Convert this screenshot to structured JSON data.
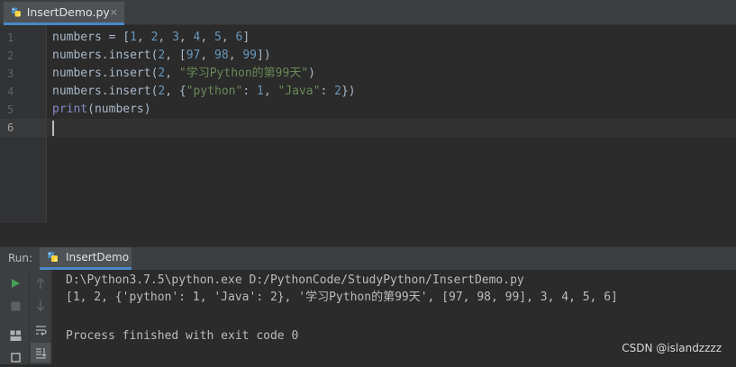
{
  "editor_tab": {
    "file_name": "InsertDemo.py",
    "close_glyph": "×"
  },
  "editor": {
    "line_numbers": [
      "1",
      "2",
      "3",
      "4",
      "5",
      "6"
    ],
    "lines": [
      [
        {
          "t": "numbers = [",
          "c": "p"
        },
        {
          "t": "1",
          "c": "n"
        },
        {
          "t": ", ",
          "c": "p"
        },
        {
          "t": "2",
          "c": "n"
        },
        {
          "t": ", ",
          "c": "p"
        },
        {
          "t": "3",
          "c": "n"
        },
        {
          "t": ", ",
          "c": "p"
        },
        {
          "t": "4",
          "c": "n"
        },
        {
          "t": ", ",
          "c": "p"
        },
        {
          "t": "5",
          "c": "n"
        },
        {
          "t": ", ",
          "c": "p"
        },
        {
          "t": "6",
          "c": "n"
        },
        {
          "t": "]",
          "c": "p"
        }
      ],
      [
        {
          "t": "numbers.insert(",
          "c": "p"
        },
        {
          "t": "2",
          "c": "n"
        },
        {
          "t": ", [",
          "c": "p"
        },
        {
          "t": "97",
          "c": "n"
        },
        {
          "t": ", ",
          "c": "p"
        },
        {
          "t": "98",
          "c": "n"
        },
        {
          "t": ", ",
          "c": "p"
        },
        {
          "t": "99",
          "c": "n"
        },
        {
          "t": "])",
          "c": "p"
        }
      ],
      [
        {
          "t": "numbers.insert(",
          "c": "p"
        },
        {
          "t": "2",
          "c": "n"
        },
        {
          "t": ", ",
          "c": "p"
        },
        {
          "t": "\"学习Python的第99天\"",
          "c": "s"
        },
        {
          "t": ")",
          "c": "p"
        }
      ],
      [
        {
          "t": "numbers.insert(",
          "c": "p"
        },
        {
          "t": "2",
          "c": "n"
        },
        {
          "t": ", {",
          "c": "p"
        },
        {
          "t": "\"python\"",
          "c": "s"
        },
        {
          "t": ": ",
          "c": "p"
        },
        {
          "t": "1",
          "c": "n"
        },
        {
          "t": ", ",
          "c": "p"
        },
        {
          "t": "\"Java\"",
          "c": "s"
        },
        {
          "t": ": ",
          "c": "p"
        },
        {
          "t": "2",
          "c": "n"
        },
        {
          "t": "})",
          "c": "p"
        }
      ],
      [
        {
          "t": "print",
          "c": "b"
        },
        {
          "t": "(numbers)",
          "c": "p"
        }
      ],
      [
        {
          "t": "",
          "c": "p"
        }
      ]
    ]
  },
  "run_panel": {
    "label": "Run:",
    "tab_name": "InsertDemo",
    "output_lines": [
      "D:\\Python3.7.5\\python.exe D:/PythonCode/StudyPython/InsertDemo.py",
      "[1, 2, {'python': 1, 'Java': 2}, '学习Python的第99天', [97, 98, 99], 3, 4, 5, 6]",
      "",
      "Process finished with exit code 0"
    ]
  },
  "watermark": "CSDN @islandzzzz",
  "colors": {
    "accent": "#4a88c7",
    "number": "#6897bb",
    "string": "#6a8759",
    "builtin": "#8888c6",
    "run_green": "#499c54"
  }
}
